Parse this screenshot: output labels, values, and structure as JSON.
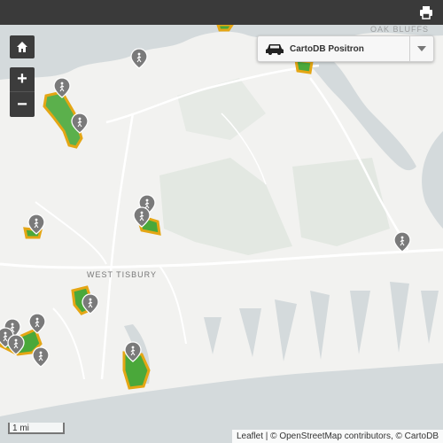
{
  "toolbar": {
    "print_icon": "print-icon"
  },
  "map": {
    "zoom_in_label": "+",
    "zoom_out_label": "−",
    "home_icon": "home-icon",
    "basemap_selector": {
      "selected": "CartoDB Positron",
      "icon": "car-icon"
    },
    "scale": "1 mi",
    "place_labels": [
      "WEST TISBURY",
      "OAK BLUFFS"
    ],
    "attribution": {
      "leaflet": "Leaflet",
      "rest": " | © OpenStreetMap contributors, © CartoDB"
    },
    "colors": {
      "water": "#d4dadc",
      "land": "#f2f2f0",
      "park": "#e3e8e2",
      "parcel_fill": "#4aa83a",
      "parcel_outline": "#e4a614",
      "marker": "#7a7a7a"
    },
    "marker_icon": "hiker-marker-icon"
  }
}
